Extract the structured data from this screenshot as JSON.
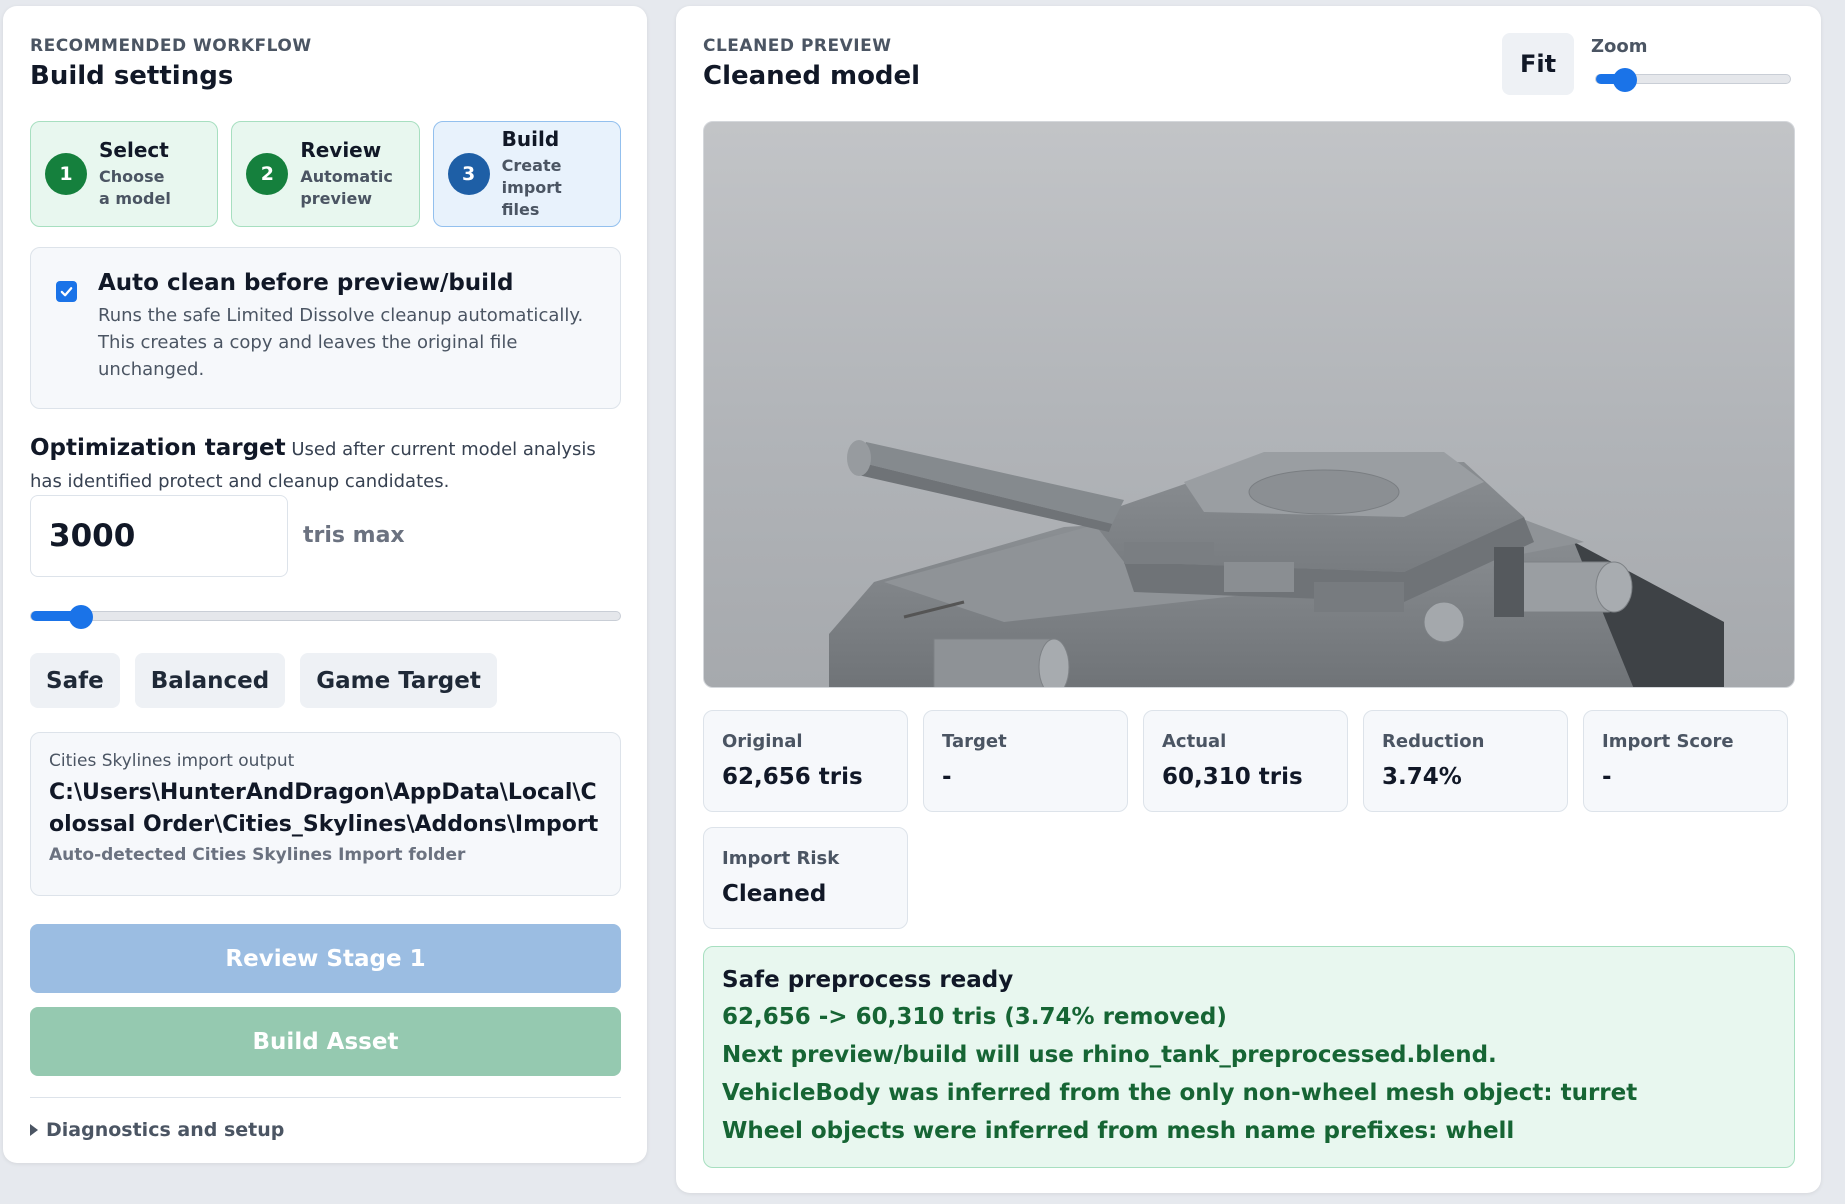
{
  "left": {
    "eyebrow": "Recommended workflow",
    "title": "Build settings",
    "steps": [
      {
        "num": "1",
        "title": "Select",
        "desc": "Choose a model"
      },
      {
        "num": "2",
        "title": "Review",
        "desc": "Automatic preview"
      },
      {
        "num": "3",
        "title": "Build",
        "desc": "Create import files"
      }
    ],
    "auto_clean": {
      "title": "Auto clean before preview/build",
      "desc": "Runs the safe Limited Dissolve cleanup automatically. This creates a copy and leaves the original file unchanged.",
      "checked": true
    },
    "optimization": {
      "label": "Optimization target",
      "desc": "Used after current model analysis has identified protect and cleanup candidates.",
      "value": "3000",
      "unit": "tris max",
      "slider_fraction": 0.085
    },
    "presets": [
      "Safe",
      "Balanced",
      "Game Target"
    ],
    "output": {
      "label": "Cities Skylines import output",
      "path": "C:\\Users\\HunterAndDragon\\AppData\\Local\\Colossal Order\\Cities_Skylines\\Addons\\Import",
      "sub": "Auto-detected Cities Skylines Import folder"
    },
    "review_button": "Review Stage 1",
    "build_button": "Build Asset",
    "diagnostics": "Diagnostics and setup"
  },
  "right": {
    "eyebrow": "Cleaned preview",
    "title": "Cleaned model",
    "fit_label": "Fit",
    "zoom_label": "Zoom",
    "zoom_fraction": 0.15,
    "stats": [
      {
        "label": "Original",
        "value": "62,656 tris"
      },
      {
        "label": "Target",
        "value": "-"
      },
      {
        "label": "Actual",
        "value": "60,310 tris"
      },
      {
        "label": "Reduction",
        "value": "3.74%"
      },
      {
        "label": "Import Score",
        "value": "-"
      }
    ],
    "risk": {
      "label": "Import Risk",
      "value": "Cleaned"
    },
    "ready": {
      "title": "Safe preprocess ready",
      "lines": [
        "62,656 -> 60,310 tris (3.74% removed)",
        "Next preview/build will use rhino_tank_preprocessed.blend.",
        "VehicleBody was inferred from the only non-wheel mesh object: turret",
        "Wheel objects were inferred from mesh name prefixes: whell"
      ]
    }
  },
  "colors": {
    "accent": "#1a73e8",
    "success_bg": "#e8f7ef",
    "success_text": "#166534"
  }
}
